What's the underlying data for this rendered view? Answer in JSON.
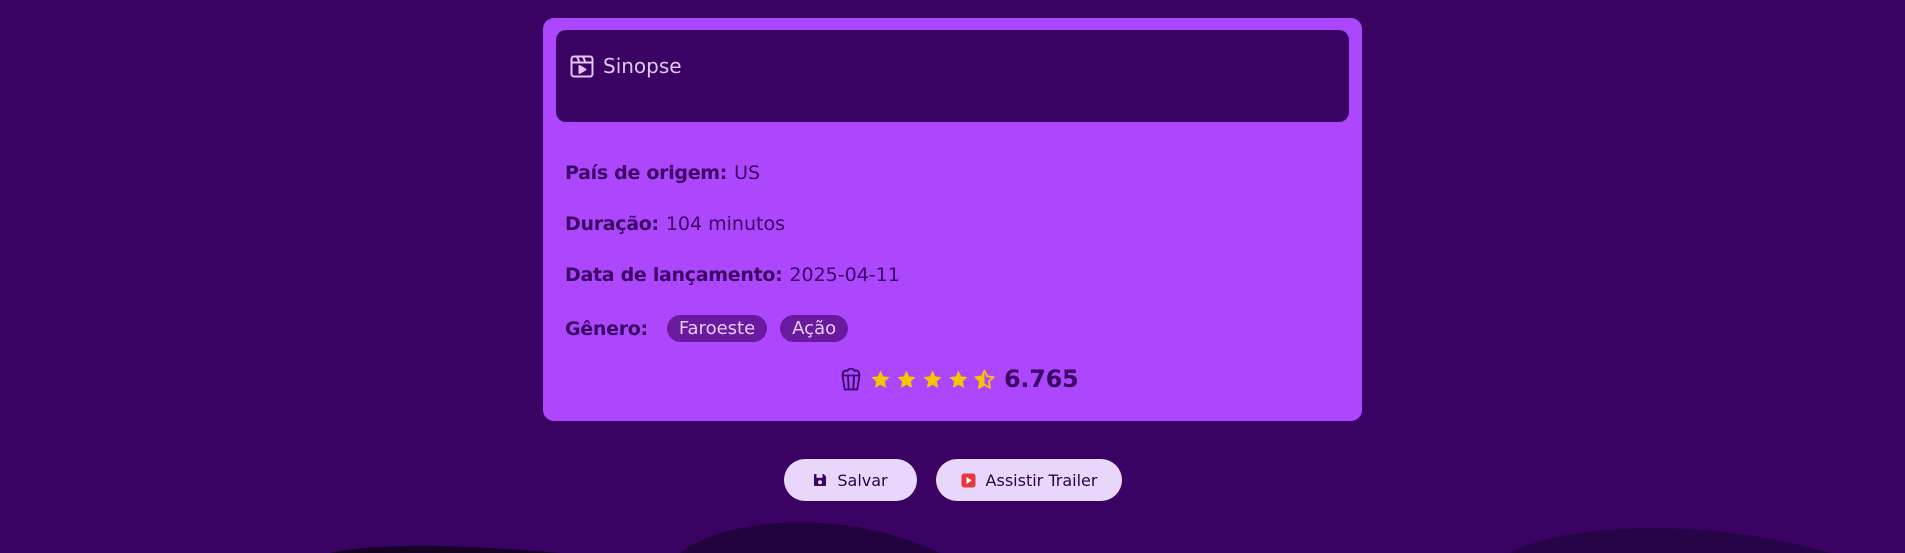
{
  "colors": {
    "background": "#3a0363",
    "card": "#ad47fd",
    "star": "#f7c400",
    "button": "#e8d7fa",
    "trailer_icon": "#e5383b"
  },
  "synopsis": {
    "icon": "clapperboard-icon",
    "title": "Sinopse"
  },
  "details": {
    "country_label": "País de origem:",
    "country_value": "US",
    "duration_label": "Duração:",
    "duration_value": "104 minutos",
    "release_label": "Data de lançamento:",
    "release_value": "2025-04-11",
    "genre_label": "Gênero:",
    "genres": [
      "Faroeste",
      "Ação"
    ]
  },
  "rating": {
    "icon": "popcorn-icon",
    "stars_full": 4,
    "stars_half": 1,
    "score": "6.765"
  },
  "actions": {
    "save_label": "Salvar",
    "save_icon": "floppy-disk-icon",
    "trailer_label": "Assistir Trailer",
    "trailer_icon": "play-icon"
  }
}
